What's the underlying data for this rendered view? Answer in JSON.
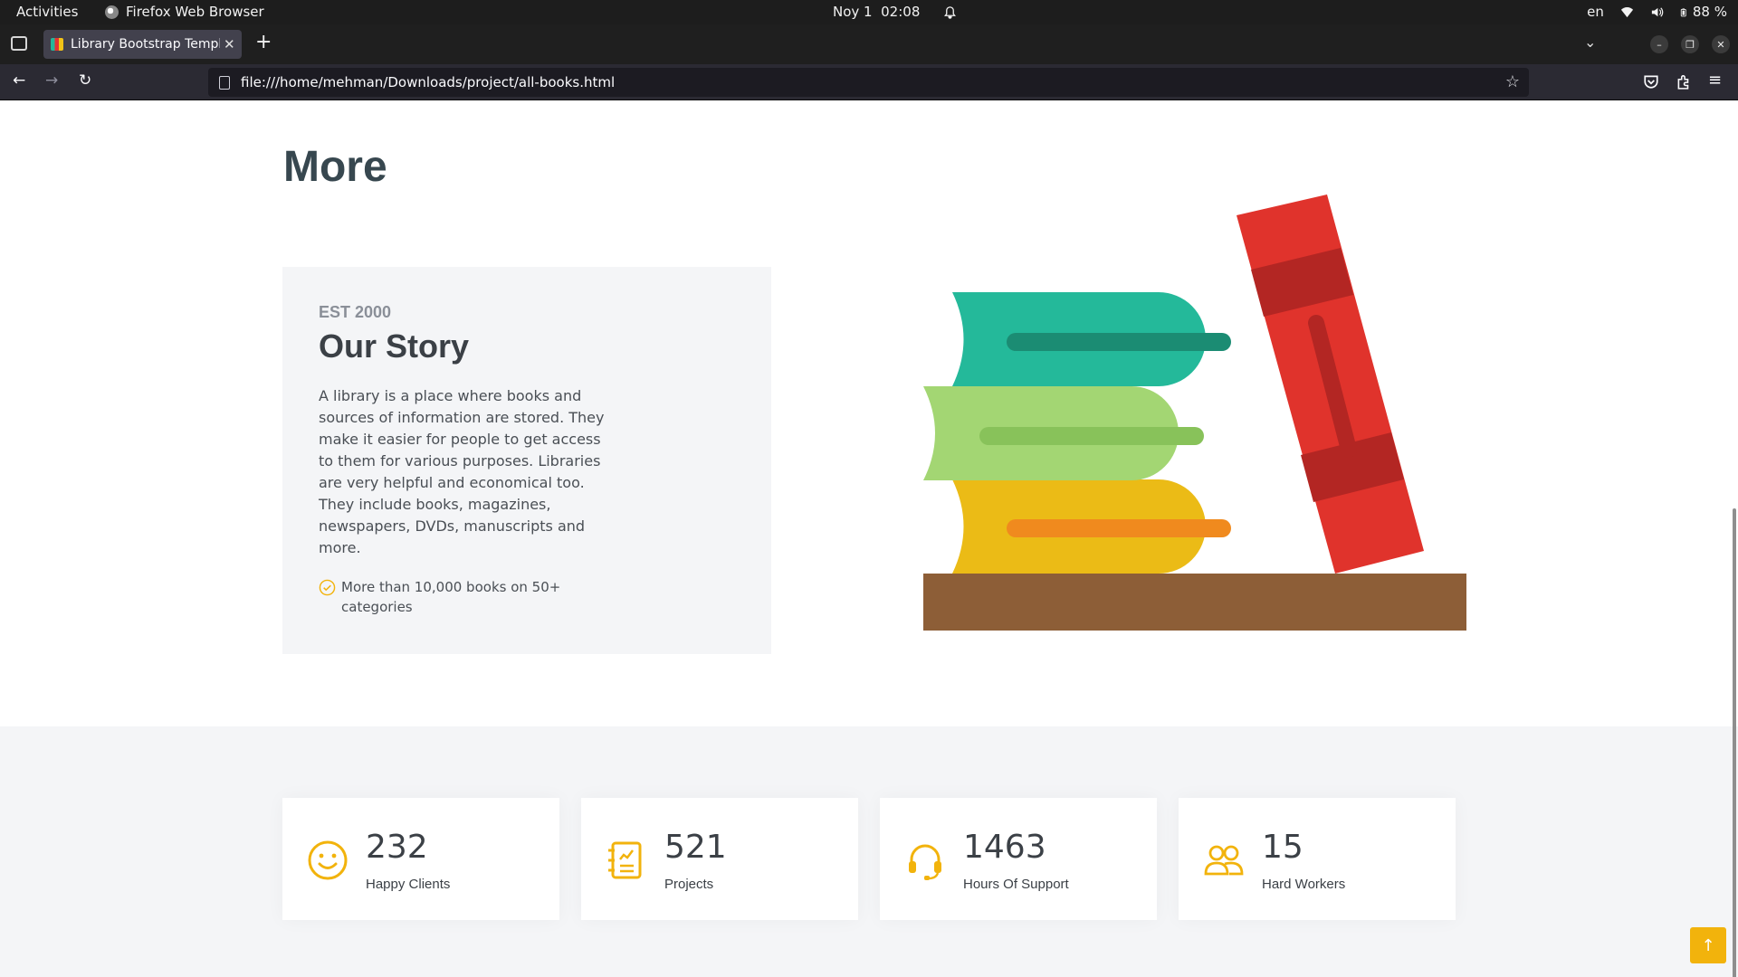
{
  "system_bar": {
    "activities": "Activities",
    "app_name": "Firefox Web Browser",
    "date": "Noy 1",
    "time": "02:08",
    "language": "en",
    "battery": "88 %"
  },
  "browser": {
    "tab_title": "Library Bootstrap Templ",
    "url": "file:///home/mehman/Downloads/project/all-books.html"
  },
  "page": {
    "section_heading": "More",
    "story": {
      "eyebrow": "EST 2000",
      "title": "Our Story",
      "text": "A library is a place where books and sources of information are stored. They make it easier for people to get access to them for various purposes. Libraries are very helpful and economical too. They include books, magazines, newspapers, DVDs, manuscripts and more.",
      "feature": "More than 10,000 books on 50+ categories"
    },
    "stats": [
      {
        "icon": "smile-icon",
        "value": "232",
        "label": "Happy Clients"
      },
      {
        "icon": "journal-icon",
        "value": "521",
        "label": "Projects"
      },
      {
        "icon": "headset-icon",
        "value": "1463",
        "label": "Hours Of Support"
      },
      {
        "icon": "people-icon",
        "value": "15",
        "label": "Hard Workers"
      }
    ],
    "accent_color": "#f2b30c"
  }
}
